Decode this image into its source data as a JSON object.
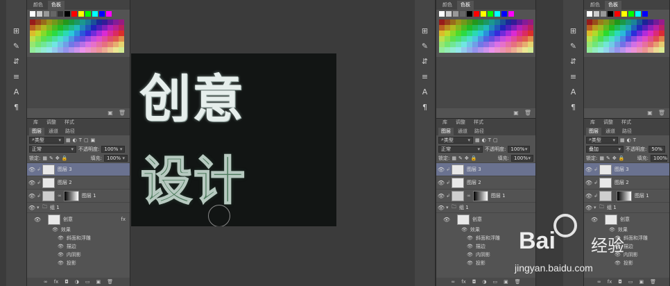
{
  "panels": {
    "top_tabs": [
      "颜色",
      "色板"
    ],
    "layer_tabs": [
      "图层",
      "通道",
      "路径"
    ],
    "adjust_tabs": [
      "库",
      "调整",
      "样式"
    ],
    "filter_kind": "类型",
    "left": {
      "blend_mode": "正常",
      "opacity_label": "不透明度:",
      "opacity_value": "100%",
      "lock_label": "锁定:",
      "fill_label": "填充:",
      "fill_value": "100%"
    },
    "right": {
      "blend_mode": "叠加",
      "opacity_label": "不透明度:",
      "opacity_value": "50%",
      "lock_label": "锁定:",
      "fill_label": "填充:",
      "fill_value": "100%"
    },
    "layers": [
      {
        "name": "图层 3",
        "selected": true
      },
      {
        "name": "图层 2",
        "selected": false
      },
      {
        "name": "图层 1",
        "selected": false,
        "has_mask": true
      }
    ],
    "group": {
      "name": "组 1"
    },
    "text_layer": {
      "name": "创意",
      "fx": "fx"
    },
    "effects_label": "效果",
    "effects": [
      "斜面和浮雕",
      "描边",
      "内阴影",
      "投影"
    ]
  },
  "canvas": {
    "line1": "创意",
    "line2": "设计"
  },
  "watermark": {
    "brand": "Bai",
    "brand_cn": "经验",
    "url": "jingyan.baidu.com"
  },
  "colors": {
    "selection": "#6a7290",
    "canvas_bg": "#121514"
  }
}
